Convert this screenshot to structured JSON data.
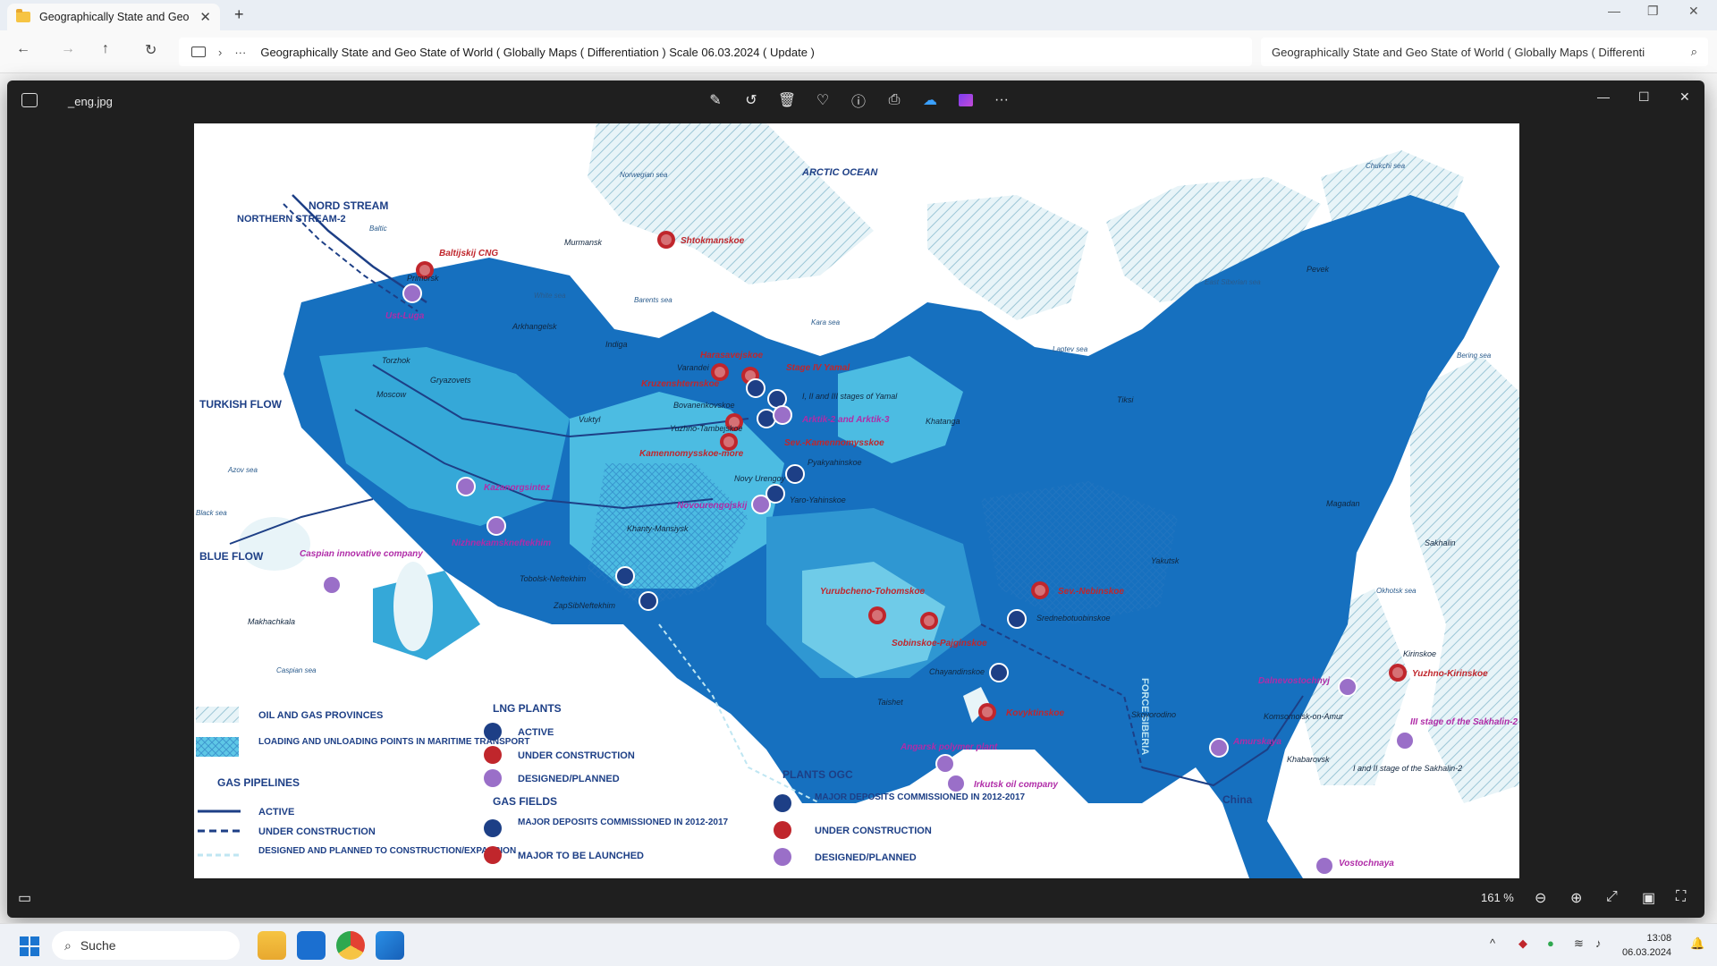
{
  "explorer": {
    "tab_title": "Geographically State and Geo",
    "breadcrumb": "Geographically State and Geo State of World ( Globally Maps ( Differentiation ) Scale 06.03.2024 ( Update )",
    "search_value": "Geographically State and Geo State of World ( Globally Maps ( Differenti"
  },
  "viewer": {
    "filename": "_eng.jpg",
    "zoom": "161 %"
  },
  "map": {
    "titles": {
      "arctic": "ARCTIC OCEAN",
      "nord_stream": "NORD STREAM",
      "northern_stream": "NORTHERN STREAM-2",
      "turkish": "TURKISH FLOW",
      "blue": "BLUE FLOW",
      "power_siberia": "FORCE SIBERIA",
      "china": "China"
    },
    "seas": [
      "Norwegian sea",
      "Baltic",
      "White sea",
      "Barents sea",
      "Kara sea",
      "Laptev sea",
      "East Siberian sea",
      "Chukchi sea",
      "Bering sea",
      "Okhotsk sea",
      "Azov sea",
      "Black sea",
      "Caspian sea"
    ],
    "red_labels": [
      "Baltijskij CNG",
      "Shtokmanskoe",
      "Harasavejskoe",
      "Stage IV Yamal",
      "Kruzenshternskoe",
      "Sev.-Kamennomysskoe",
      "Kamennomysskoe-more",
      "Yurubcheno-Tohomskoe",
      "Sobinskoe-Pajginskoe",
      "Sev.-Nebinskoe",
      "Kovyktinskoe",
      "Yuzhno-Kirinskoe"
    ],
    "purple_labels": [
      "Ust-Luga",
      "Kazanorgsintez",
      "Nizhnekamskneftekhim",
      "Caspian innovative company",
      "Novourengojskij",
      "Arktik-2 and Arktik-3",
      "Angarsk polymer plant",
      "Irkutsk oil company",
      "Dalnevostochnyj",
      "Amurskaya",
      "Vostochnaya",
      "III stage of the Sakhalin-2"
    ],
    "dark_labels": [
      "Murmansk",
      "Primorsk",
      "Arkhangelsk",
      "Indiga",
      "Torzhok",
      "Gryazovets",
      "Moscow",
      "Varandei",
      "Bovanenkovskoe",
      "I, II and III stages of Yamal",
      "Yuzhno-Tambejskoe",
      "Pyakyahinskoe",
      "Novy Urengoy",
      "Yaro-Yahinskoe",
      "Khanty-Mansiysk",
      "Tobolsk-Neftekhim",
      "ZapSibNeftekhim",
      "Makhachkala",
      "Vuktyl",
      "Khatanga",
      "Tiksi",
      "Pevek",
      "Magadan",
      "Yakutsk",
      "Srednebotuobinskoe",
      "Chayandinskoe",
      "Taishet",
      "Skovorodino",
      "Komsomolsk-on-Amur",
      "Khabarovsk",
      "Kirinskoe",
      "Sakhalin",
      "I and II stage of the Sakhalin-2"
    ],
    "legend": {
      "provinces": "OIL AND GAS PROVINCES",
      "loading": "LOADING AND UNLOADING POINTS IN MARITIME TRANSPORT",
      "pipelines_head": "GAS PIPELINES",
      "pipe_active": "ACTIVE",
      "pipe_construction": "UNDER CONSTRUCTION",
      "pipe_planned": "DESIGNED AND PLANNED TO CONSTRUCTION/EXPANSION",
      "lng_head": "LNG PLANTS",
      "lng_active": "ACTIVE",
      "lng_construction": "UNDER CONSTRUCTION",
      "lng_planned": "DESIGNED/PLANNED",
      "fields_head": "GAS FIELDS",
      "fields_commissioned": "MAJOR DEPOSITS COMMISSIONED IN 2012-2017",
      "fields_launch": "MAJOR TO BE LAUNCHED",
      "ogc_head": "PLANTS OGC",
      "ogc_commissioned": "MAJOR DEPOSITS COMMISSIONED IN 2012-2017",
      "ogc_construction": "UNDER CONSTRUCTION",
      "ogc_planned": "DESIGNED/PLANNED"
    }
  },
  "taskbar": {
    "search_label": "Suche",
    "time": "13:08",
    "date": "06.03.2024"
  }
}
